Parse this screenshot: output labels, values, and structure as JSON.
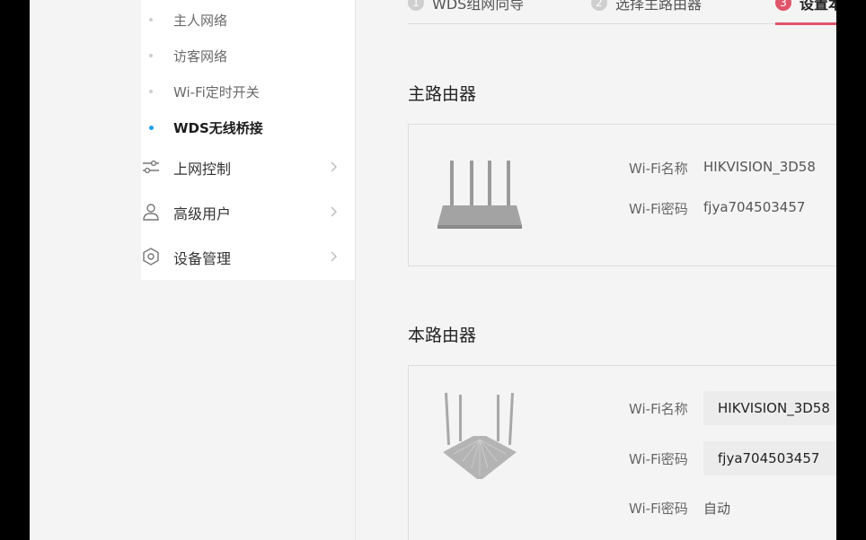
{
  "sidebar": {
    "sub_items": [
      {
        "label": "主人网络"
      },
      {
        "label": "访客网络"
      },
      {
        "label": "Wi-Fi定时开关"
      },
      {
        "label": "WDS无线桥接"
      }
    ],
    "menu_items": [
      {
        "label": "上网控制",
        "icon": "sliders-icon"
      },
      {
        "label": "高级用户",
        "icon": "user-icon"
      },
      {
        "label": "设备管理",
        "icon": "device-gear-icon"
      }
    ]
  },
  "steps": [
    {
      "num": "1",
      "label": "WDS组网向导"
    },
    {
      "num": "2",
      "label": "选择主路由器"
    },
    {
      "num": "3",
      "label": "设置本"
    }
  ],
  "main_router": {
    "title": "主路由器",
    "wifi_name_label": "Wi-Fi名称",
    "wifi_name": "HIKVISION_3D58",
    "wifi_password_label": "Wi-Fi密码",
    "wifi_password": "fjya704503457"
  },
  "this_router": {
    "title": "本路由器",
    "wifi_name_label": "Wi-Fi名称",
    "wifi_name": "HIKVISION_3D58",
    "wifi_password_label": "Wi-Fi密码",
    "wifi_password": "fjya704503457",
    "wifi_password_label_2": "Wi-Fi密码",
    "mode_value": "自动"
  },
  "colors": {
    "accent_step": "#e0556a",
    "active_dot": "#1aa0e6"
  }
}
